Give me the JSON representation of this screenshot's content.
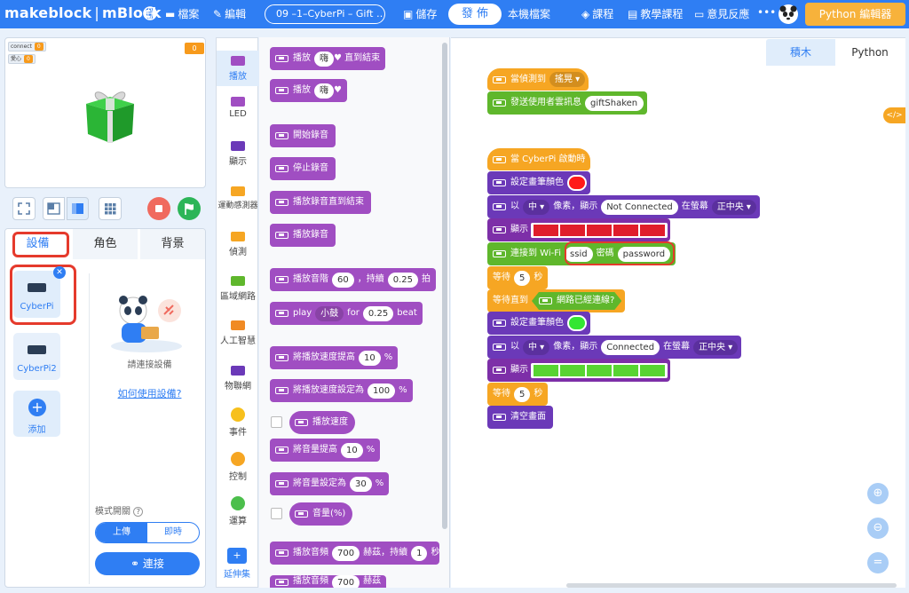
{
  "topbar": {
    "logo_brand": "makeblock",
    "logo_sep": "|",
    "logo_product": "mBlock",
    "menu_file": "檔案",
    "menu_edit": "編輯",
    "project_name": "09 –1–CyberPi – Gift …",
    "save": "儲存",
    "publish": "發 佈",
    "local_file": "本機檔案",
    "courses": "課程",
    "tutorials": "教學課程",
    "feedback": "意見反應",
    "more": "•••",
    "python_editor": "Python 編輯器"
  },
  "stage": {
    "monitors": [
      {
        "label": "connect",
        "value": "0"
      },
      {
        "label": "愛心",
        "value": "0"
      }
    ],
    "counter": "0"
  },
  "device_panel": {
    "tabs": [
      {
        "label": "設備",
        "active": true
      },
      {
        "label": "角色",
        "active": false
      },
      {
        "label": "背景",
        "active": false
      }
    ],
    "devices": [
      {
        "name": "CyberPi",
        "selected": true
      },
      {
        "name": "CyberPi2",
        "selected": false
      }
    ],
    "add_label": "添加",
    "connect_hint": "請連接設備",
    "howto_link": "如何使用設備?",
    "mode_label": "模式開關",
    "mode_help": "?",
    "mode_options": [
      "上傳",
      "即時"
    ],
    "connect_button": "連接"
  },
  "categories": [
    {
      "label": "播放",
      "color": "#a04ec2",
      "active": true
    },
    {
      "label": "LED",
      "color": "#a04ec2",
      "active": false
    },
    {
      "label": "顯示",
      "color": "#6b39b8",
      "active": false
    },
    {
      "label": "運動感測器",
      "color": "#f6a623",
      "active": false
    },
    {
      "label": "偵測",
      "color": "#f6a623",
      "active": false
    },
    {
      "label": "區域網路",
      "color": "#5fb72c",
      "active": false
    },
    {
      "label": "人工智慧",
      "color": "#f08a24",
      "active": false
    },
    {
      "label": "物聯網",
      "color": "#6b39b8",
      "active": false
    },
    {
      "label": "事件",
      "color": "#f7c01c",
      "active": false
    },
    {
      "label": "控制",
      "color": "#f6a623",
      "active": false
    },
    {
      "label": "運算",
      "color": "#4cbf4c",
      "active": false
    }
  ],
  "extension_label": "延伸集",
  "palette": {
    "play_until_done": {
      "pre": "播放",
      "sound": "嗨",
      "post": "直到結束"
    },
    "play": {
      "pre": "播放",
      "sound": "嗨"
    },
    "start_record": "開始錄音",
    "stop_record": "停止錄音",
    "play_record_until_done": "播放錄音直到結束",
    "play_record": "播放錄音",
    "play_note": {
      "pre": "播放音階",
      "note": "60",
      "mid": "，持續",
      "beats": "0.25",
      "post": "拍"
    },
    "play_drum": {
      "pre": "play",
      "drum": "小鼓",
      "mid": "for",
      "beats": "0.25",
      "post": "beat"
    },
    "speed_up": {
      "pre": "將播放速度提高",
      "value": "10",
      "post": "%"
    },
    "speed_set": {
      "pre": "將播放速度設定為",
      "value": "100",
      "post": "%"
    },
    "speed_reporter": "播放速度",
    "volume_up": {
      "pre": "將音量提高",
      "value": "10",
      "post": "%"
    },
    "volume_set": {
      "pre": "將音量設定為",
      "value": "30",
      "post": "%"
    },
    "volume_reporter": "音量(%)",
    "play_freq": {
      "pre": "播放音頻",
      "value": "700",
      "mid": "赫茲，持續",
      "secs": "1",
      "post": "秒"
    },
    "play_freq2": {
      "pre": "播放音頻",
      "value": "700",
      "post": "赫茲"
    }
  },
  "workspace": {
    "tabs": [
      "積木",
      "Python"
    ],
    "script1": {
      "hat": {
        "pre": "當偵測到",
        "option": "搖晃"
      },
      "send": {
        "pre": "發送使用者雲訊息",
        "value": "giftShaken"
      }
    },
    "script2": {
      "hat": "當 CyberPi 啟動時",
      "set_color1": "設定畫筆顏色",
      "print1": {
        "pre": "以",
        "size": "中",
        "mid": "像素，顯示",
        "text": "Not Connected",
        "mid2": "在螢幕",
        "pos": "正中央"
      },
      "show1": "顯示",
      "wifi": {
        "pre": "連接到 Wi-Fi",
        "ssid": "ssid",
        "mid": "密碼",
        "password": "password"
      },
      "wait1": {
        "pre": "等待",
        "value": "5",
        "post": "秒"
      },
      "wait_until": {
        "pre": "等待直到",
        "cond": "網路已經連線?"
      },
      "set_color2": "設定畫筆顏色",
      "print2": {
        "pre": "以",
        "size": "中",
        "mid": "像素，顯示",
        "text": "Connected",
        "mid2": "在螢幕",
        "pos": "正中央"
      },
      "show2": "顯示",
      "wait2": {
        "pre": "等待",
        "value": "5",
        "post": "秒"
      },
      "clear": "清空畫面"
    },
    "colors": {
      "pen_red": "#ff1a1a",
      "pen_green": "#33e633",
      "matrix_red": "#e01e2b",
      "matrix_green": "#58d432",
      "highlight": "#e53a2c",
      "accent": "#2f7ef3"
    }
  }
}
